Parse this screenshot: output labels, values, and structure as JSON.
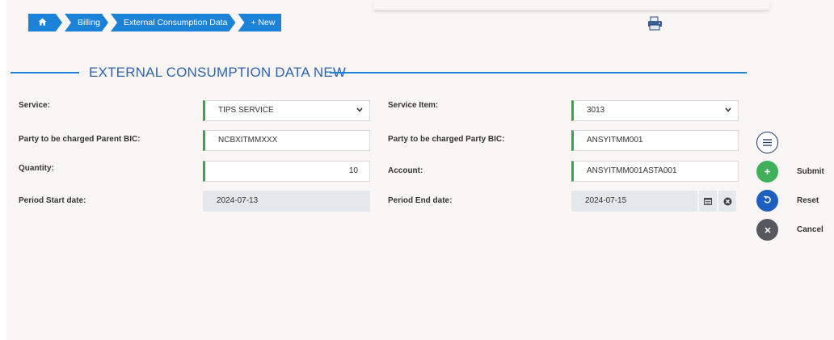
{
  "breadcrumb": {
    "home_icon": "home-icon",
    "items": [
      "Billing",
      "External Consumption Data"
    ],
    "new_label": "+ New"
  },
  "toolbar": {
    "print_icon": "printer-icon"
  },
  "page": {
    "title": "EXTERNAL CONSUMPTION DATA NEW"
  },
  "form": {
    "service": {
      "label": "Service:",
      "value": "TIPS SERVICE"
    },
    "service_item": {
      "label": "Service Item:",
      "value": "3013"
    },
    "parent_bic": {
      "label": "Party to be charged Parent BIC:",
      "value": "NCBXITMMXXX"
    },
    "party_bic": {
      "label": "Party to be charged Party BIC:",
      "value": "ANSYITMM001"
    },
    "quantity": {
      "label": "Quantity:",
      "value": "10"
    },
    "account": {
      "label": "Account:",
      "value": "ANSYITMM001ASTA001"
    },
    "start_date": {
      "label": "Period Start date:",
      "value": "2024-07-13"
    },
    "end_date": {
      "label": "Period End date:",
      "value": "2024-07-15"
    }
  },
  "actions": {
    "submit_label": "Submit",
    "reset_label": "Reset",
    "cancel_label": "Cancel"
  },
  "colors": {
    "accent": "#1b82d8",
    "title": "#2f63ad",
    "mandatory": "#3aa44a",
    "submit": "#3fb05a",
    "reset": "#1d5fbf",
    "cancel": "#55595f"
  }
}
